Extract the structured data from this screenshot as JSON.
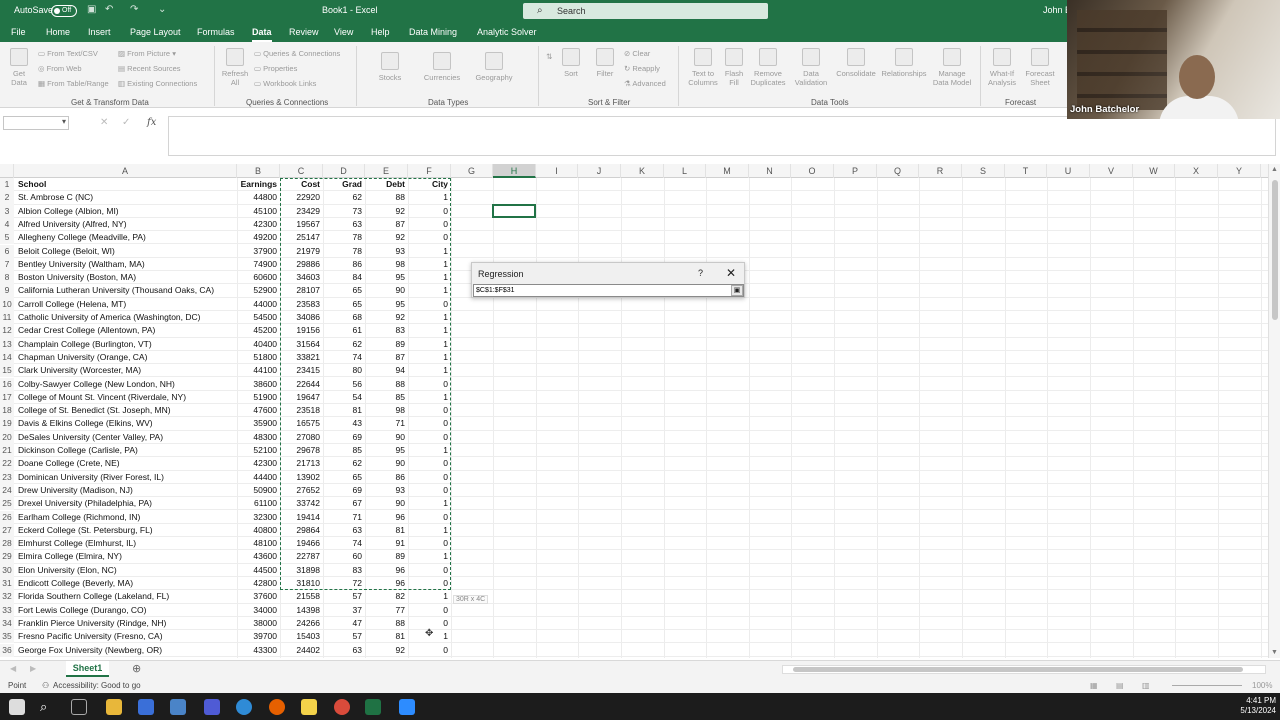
{
  "titlebar": {
    "autosave_label": "AutoSave",
    "autosave_state": "Off",
    "doc_title": "Book1 - Excel",
    "search_placeholder": "Search",
    "user_short": "John B"
  },
  "menu": {
    "tabs": [
      "File",
      "Home",
      "Insert",
      "Page Layout",
      "Formulas",
      "Data",
      "Review",
      "View",
      "Help",
      "Data Mining",
      "Analytic Solver"
    ],
    "active": "Data"
  },
  "ribbon": {
    "get_data": "Get\nData",
    "from_text_csv": "From Text/CSV",
    "from_web": "From Web",
    "from_table_range": "From Table/Range",
    "from_picture": "From Picture",
    "recent_sources": "Recent Sources",
    "existing_connections": "Existing Connections",
    "group_get_transform": "Get & Transform Data",
    "refresh_all": "Refresh\nAll",
    "queries_connections": "Queries & Connections",
    "properties": "Properties",
    "workbook_links": "Workbook Links",
    "group_queries": "Queries & Connections",
    "stocks": "Stocks",
    "currencies": "Currencies",
    "geography": "Geography",
    "group_data_types": "Data Types",
    "sort": "Sort",
    "filter": "Filter",
    "clear": "Clear",
    "reapply": "Reapply",
    "advanced": "Advanced",
    "group_sort_filter": "Sort & Filter",
    "text_to_columns": "Text to\nColumns",
    "flash_fill": "Flash\nFill",
    "remove_duplicates": "Remove\nDuplicates",
    "data_validation": "Data\nValidation",
    "consolidate": "Consolidate",
    "relationships": "Relationships",
    "manage_data_model": "Manage\nData Model",
    "group_data_tools": "Data Tools",
    "what_if": "What-If\nAnalysis",
    "forecast_sheet": "Forecast\nSheet",
    "group_forecast": "Forecast"
  },
  "formula_bar": {
    "name_box": "",
    "cancel": "✕",
    "enter": "✓",
    "fx": "fx",
    "content": ""
  },
  "columns": [
    "A",
    "B",
    "C",
    "D",
    "E",
    "F",
    "G",
    "H",
    "I",
    "J",
    "K",
    "L",
    "M",
    "N",
    "O",
    "P",
    "Q",
    "R",
    "S",
    "T",
    "U",
    "V",
    "W",
    "X",
    "Y"
  ],
  "selected_column": "H",
  "headers": [
    "School",
    "Earnings",
    "Cost",
    "Grad",
    "Debt",
    "City"
  ],
  "rows": [
    [
      "St. Ambrose C (NC)",
      "44800",
      "22920",
      "62",
      "88",
      "1"
    ],
    [
      "Albion College (Albion, MI)",
      "45100",
      "23429",
      "73",
      "92",
      "0"
    ],
    [
      "Alfred University (Alfred, NY)",
      "42300",
      "19567",
      "63",
      "87",
      "0"
    ],
    [
      "Allegheny College (Meadville, PA)",
      "49200",
      "25147",
      "78",
      "92",
      "0"
    ],
    [
      "Beloit College (Beloit, WI)",
      "37900",
      "21979",
      "78",
      "93",
      "1"
    ],
    [
      "Bentley University (Waltham, MA)",
      "74900",
      "29886",
      "86",
      "98",
      "1"
    ],
    [
      "Boston University (Boston, MA)",
      "60600",
      "34603",
      "84",
      "95",
      "1"
    ],
    [
      "California Lutheran University (Thousand Oaks, CA)",
      "52900",
      "28107",
      "65",
      "90",
      "1"
    ],
    [
      "Carroll College (Helena, MT)",
      "44000",
      "23583",
      "65",
      "95",
      "0"
    ],
    [
      "Catholic University of America (Washington, DC)",
      "54500",
      "34086",
      "68",
      "92",
      "1"
    ],
    [
      "Cedar Crest College (Allentown, PA)",
      "45200",
      "19156",
      "61",
      "83",
      "1"
    ],
    [
      "Champlain College (Burlington, VT)",
      "40400",
      "31564",
      "62",
      "89",
      "1"
    ],
    [
      "Chapman University (Orange, CA)",
      "51800",
      "33821",
      "74",
      "87",
      "1"
    ],
    [
      "Clark University (Worcester, MA)",
      "44100",
      "23415",
      "80",
      "94",
      "1"
    ],
    [
      "Colby-Sawyer College (New London, NH)",
      "38600",
      "22644",
      "56",
      "88",
      "0"
    ],
    [
      "College of Mount St. Vincent (Riverdale, NY)",
      "51900",
      "19647",
      "54",
      "85",
      "1"
    ],
    [
      "College of St. Benedict (St. Joseph, MN)",
      "47600",
      "23518",
      "81",
      "98",
      "0"
    ],
    [
      "Davis & Elkins College (Elkins, WV)",
      "35900",
      "16575",
      "43",
      "71",
      "0"
    ],
    [
      "DeSales University (Center Valley, PA)",
      "48300",
      "27080",
      "69",
      "90",
      "0"
    ],
    [
      "Dickinson College (Carlisle, PA)",
      "52100",
      "29678",
      "85",
      "95",
      "1"
    ],
    [
      "Doane College (Crete, NE)",
      "42300",
      "21713",
      "62",
      "90",
      "0"
    ],
    [
      "Dominican University (River Forest, IL)",
      "44400",
      "13902",
      "65",
      "86",
      "0"
    ],
    [
      "Drew University (Madison, NJ)",
      "50900",
      "27652",
      "69",
      "93",
      "0"
    ],
    [
      "Drexel University (Philadelphia, PA)",
      "61100",
      "33742",
      "67",
      "90",
      "1"
    ],
    [
      "Earlham College (Richmond, IN)",
      "32300",
      "19414",
      "71",
      "96",
      "0"
    ],
    [
      "Eckerd College (St. Petersburg, FL)",
      "40800",
      "29864",
      "63",
      "81",
      "1"
    ],
    [
      "Elmhurst College (Elmhurst, IL)",
      "48100",
      "19466",
      "74",
      "91",
      "0"
    ],
    [
      "Elmira College (Elmira, NY)",
      "43600",
      "22787",
      "60",
      "89",
      "1"
    ],
    [
      "Elon University (Elon, NC)",
      "44500",
      "31898",
      "83",
      "96",
      "0"
    ],
    [
      "Endicott College (Beverly, MA)",
      "42800",
      "31810",
      "72",
      "96",
      "0"
    ],
    [
      "Florida Southern College (Lakeland, FL)",
      "37600",
      "21558",
      "57",
      "82",
      "1"
    ],
    [
      "Fort Lewis College (Durango, CO)",
      "34000",
      "14398",
      "37",
      "77",
      "0"
    ],
    [
      "Franklin Pierce University (Rindge, NH)",
      "38000",
      "24266",
      "47",
      "88",
      "0"
    ],
    [
      "Fresno Pacific University (Fresno, CA)",
      "39700",
      "15403",
      "57",
      "81",
      "1"
    ],
    [
      "George Fox University (Newberg, OR)",
      "43300",
      "24402",
      "63",
      "92",
      "0"
    ]
  ],
  "selection_tip": "30R x 4C",
  "dialog": {
    "title": "Regression",
    "help": "?",
    "close": "✕",
    "range_value": "$C$1:$F$31"
  },
  "sheets": [
    "Sheet1"
  ],
  "status": {
    "mode": "Point",
    "accessibility": "Accessibility: Good to go",
    "zoom": "100%"
  },
  "taskbar": {
    "time": "4:41 PM",
    "date": "5/13/2024"
  },
  "webcam": {
    "name": "John Batchelor"
  }
}
